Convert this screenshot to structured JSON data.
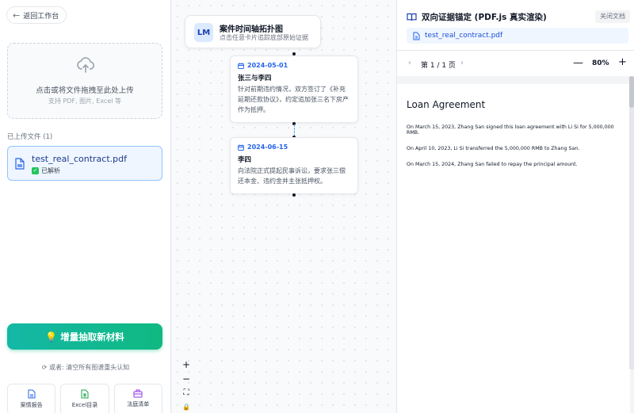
{
  "left": {
    "back_label": "返回工作台",
    "upload_title": "点击或将文件拖拽至此处上传",
    "upload_subtitle": "支持 PDF, 图片, Excel 等",
    "files_label": "已上传文件 (1)",
    "files": [
      {
        "name": "test_real_contract.pdf",
        "status": "已解析"
      }
    ],
    "extract_button": "增量抽取新材料",
    "hint": "或者: 清空所有图谱重头认知",
    "bottom_buttons": [
      "案情报告",
      "Excel目录",
      "法庭清单"
    ]
  },
  "canvas": {
    "badge": "LM",
    "title": "案件时间轴拓扑图",
    "subtitle": "点击任意卡片追踪底部原始证据",
    "events": [
      {
        "date": "2024-05-01",
        "parties": "张三与李四",
        "description": "针对前期违约情况，双方签订了《补充延期还款协议》，约定追加张三名下房产作为抵押。"
      },
      {
        "date": "2024-06-15",
        "parties": "李四",
        "description": "向法院正式提起民事诉讼，要求张三偿还本金、违约金并主张抵押权。"
      }
    ],
    "zoom_controls": [
      "+",
      "−",
      "⛶",
      "🔒"
    ]
  },
  "right": {
    "title": "双向证据锚定 (PDF.js 真实渲染)",
    "close_label": "关闭文档",
    "doc_name": "test_real_contract.pdf",
    "prev": "‹",
    "next": "›",
    "page_label": "第 1 / 1 页",
    "zoom_minus": "—",
    "zoom_value": "80%",
    "zoom_plus": "+",
    "pdf": {
      "heading": "Loan Agreement",
      "lines": [
        "On March 15, 2023, Zhang San signed this loan agreement with Li Si for 5,000,000 RMB.",
        "On April 10, 2023, Li Si transferred the 5,000,000 RMB to Zhang San.",
        "On March 15, 2024, Zhang San failed to repay the principal amount."
      ]
    }
  },
  "colors": {
    "accent": "#2563eb",
    "extract_gradient_start": "#14b8a6",
    "extract_gradient_end": "#10b981",
    "parsed_check": "#22c55e"
  }
}
